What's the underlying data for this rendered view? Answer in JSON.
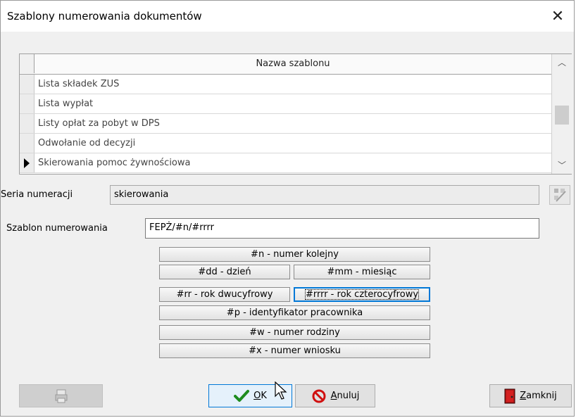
{
  "dialog": {
    "title": "Szablony numerowania dokumentów"
  },
  "grid": {
    "header": "Nazwa szablonu",
    "rows": [
      "Lista składek ZUS",
      "Lista wypłat",
      "Listy opłat za pobyt w DPS",
      "Odwołanie od decyzji",
      "Skierowania pomoc żywnościowa"
    ],
    "selected_index": 4
  },
  "form": {
    "series_label": "Seria numeracji",
    "series_value": "skierowania",
    "template_label": "Szablon numerowania",
    "template_value": "FEPŻ/#n/#rrrr"
  },
  "tokens": {
    "n": "#n - numer kolejny",
    "dd": "#dd - dzień",
    "mm": "#mm - miesiąc",
    "rr": "#rr - rok dwucyfrowy",
    "rrrr": "#rrrr - rok czterocyfrowy",
    "p": "#p - identyfikator pracownika",
    "w": "#w - numer rodziny",
    "x": "#x - numer wniosku"
  },
  "buttons": {
    "ok_first": "O",
    "ok_rest": "K",
    "cancel_first": "A",
    "cancel_rest": "nuluj",
    "close_first": "Z",
    "close_rest": "amknij"
  }
}
